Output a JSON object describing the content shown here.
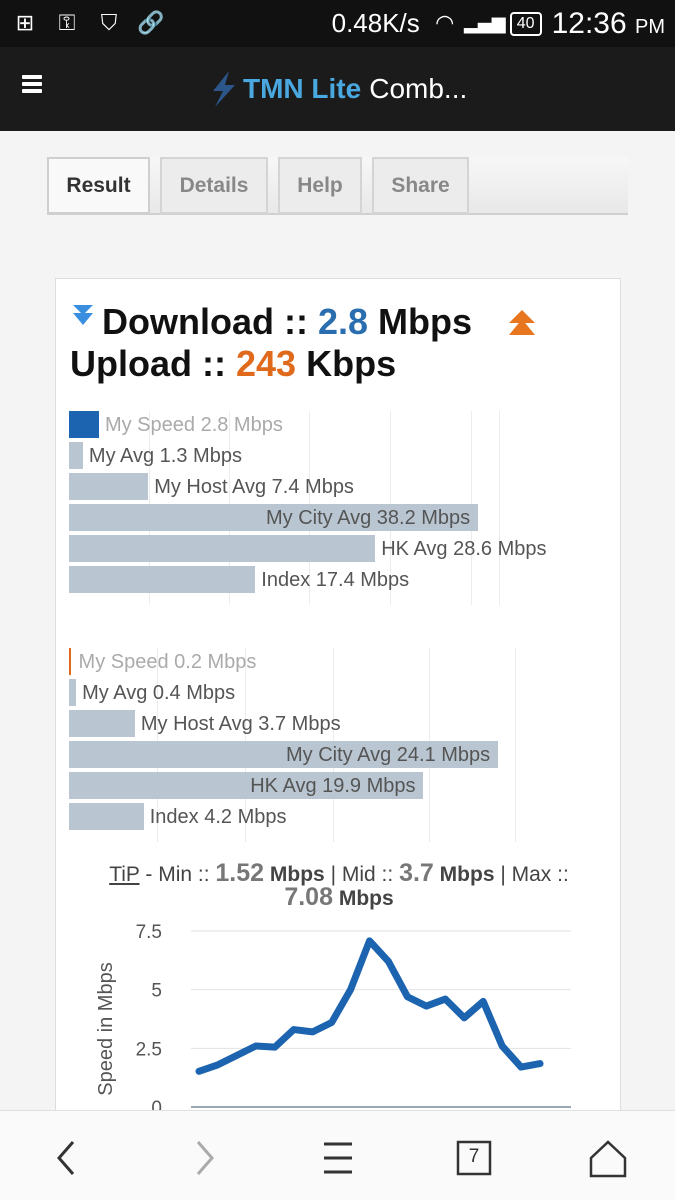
{
  "status": {
    "net_speed": "0.48K/s",
    "battery": "40",
    "time": "12:36",
    "ampm": "PM"
  },
  "app": {
    "name": "TMN Lite",
    "title_rest": "Comb..."
  },
  "tabs": [
    {
      "label": "Result"
    },
    {
      "label": "Details"
    },
    {
      "label": "Help"
    },
    {
      "label": "Share"
    }
  ],
  "result": {
    "download_label": "Download ::",
    "download_value": "2.8",
    "download_unit": "Mbps",
    "upload_label": "Upload ::",
    "upload_value": "243",
    "upload_unit": "Kbps"
  },
  "download_bars": [
    {
      "label": "My Speed 2.8 Mbps",
      "value": 2.8
    },
    {
      "label": "My Avg 1.3 Mbps",
      "value": 1.3
    },
    {
      "label": "My Host Avg 7.4 Mbps",
      "value": 7.4
    },
    {
      "label": "My City Avg 38.2 Mbps",
      "value": 38.2
    },
    {
      "label": "HK Avg 28.6 Mbps",
      "value": 28.6
    },
    {
      "label": "Index 17.4 Mbps",
      "value": 17.4
    }
  ],
  "upload_bars": [
    {
      "label": "My Speed 0.2 Mbps",
      "value": 0.2
    },
    {
      "label": "My Avg 0.4 Mbps",
      "value": 0.4
    },
    {
      "label": "My Host Avg 3.7 Mbps",
      "value": 3.7
    },
    {
      "label": "My City Avg 24.1 Mbps",
      "value": 24.1
    },
    {
      "label": "HK Avg 19.9 Mbps",
      "value": 19.9
    },
    {
      "label": "Index 4.2 Mbps",
      "value": 4.2
    }
  ],
  "tip": {
    "tip_word": "TiP",
    "min_label": "- Min ::",
    "min_value": "1.52",
    "mid_label": "| Mid ::",
    "mid_value": "3.7",
    "max_label": "| Max ::",
    "max_value": "7.08",
    "unit": "Mbps"
  },
  "chart_data": {
    "type": "line",
    "ylabel": "Speed in Mbps",
    "yticks": [
      "7.5",
      "5",
      "2.5",
      "0"
    ],
    "ylim": [
      0,
      7.5
    ],
    "x": [
      1,
      2,
      3,
      4,
      5,
      6,
      7,
      8,
      9,
      10,
      11,
      12,
      13,
      14,
      15,
      16,
      17,
      18,
      19,
      20
    ],
    "series": [
      {
        "values": [
          1.52,
          1.8,
          2.2,
          2.6,
          2.55,
          3.3,
          3.2,
          3.6,
          5.0,
          7.08,
          6.2,
          4.7,
          4.3,
          4.6,
          3.8,
          4.5,
          2.6,
          1.7,
          1.85,
          null
        ]
      }
    ],
    "grid": true,
    "color": "#1d64b0"
  },
  "nav": {
    "tabs_count": "7"
  },
  "colors": {
    "download_accent": "#2a6eb0",
    "upload_accent": "#e06a1c",
    "bar_gray": "#b9c6d1",
    "brand": "#4aa8e0"
  }
}
